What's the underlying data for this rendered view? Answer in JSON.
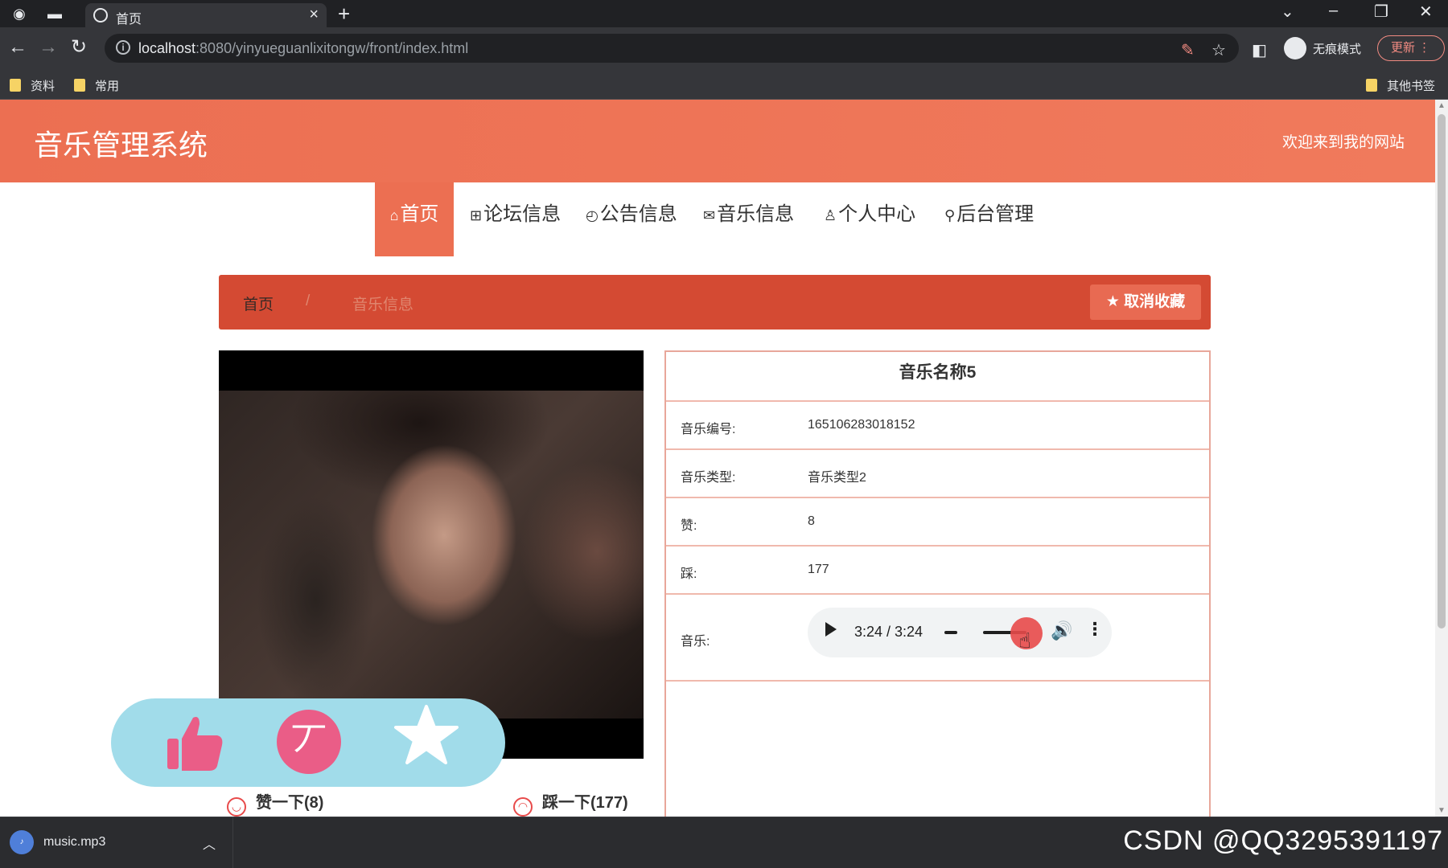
{
  "browser": {
    "tab_title": "首页",
    "url_host": "localhost",
    "url_rest": ":8080/yinyueguanlixitongw/front/index.html",
    "incognito_label": "无痕模式",
    "update_label": "更新",
    "bookmarks": [
      "资料",
      "常用"
    ],
    "other_bookmarks": "其他书签"
  },
  "header": {
    "site_title": "音乐管理系统",
    "welcome": "欢迎来到我的网站"
  },
  "nav": {
    "items": [
      {
        "icon": "⌂",
        "label": "首页"
      },
      {
        "icon": "⊞",
        "label": "论坛信息"
      },
      {
        "icon": "◴",
        "label": "公告信息"
      },
      {
        "icon": "✉",
        "label": "音乐信息"
      },
      {
        "icon": "♙",
        "label": "个人中心"
      },
      {
        "icon": "⚲",
        "label": "后台管理"
      }
    ]
  },
  "breadcrumb": {
    "home": "首页",
    "separator": "/",
    "current": "音乐信息",
    "unfavorite_label": "取消收藏"
  },
  "detail": {
    "title": "音乐名称5",
    "rows": [
      {
        "label": "音乐编号:",
        "value": "165106283018152"
      },
      {
        "label": "音乐类型:",
        "value": "音乐类型2"
      },
      {
        "label": "赞:",
        "value": "8"
      },
      {
        "label": "踩:",
        "value": "177"
      }
    ],
    "music_label": "音乐:",
    "player_time": "3:24 / 3:24"
  },
  "votes": {
    "like_label": "赞一下(8)",
    "dislike_label": "踩一下(177)"
  },
  "shelf": {
    "file_name": "music.mp3",
    "watermark": "CSDN @QQ3295391197"
  },
  "colors": {
    "accent": "#ec6f52",
    "breadcrumb_bg": "#d44a33",
    "vote_panel_bg": "#a1dcea",
    "dislike_pink": "#ea5d87"
  }
}
